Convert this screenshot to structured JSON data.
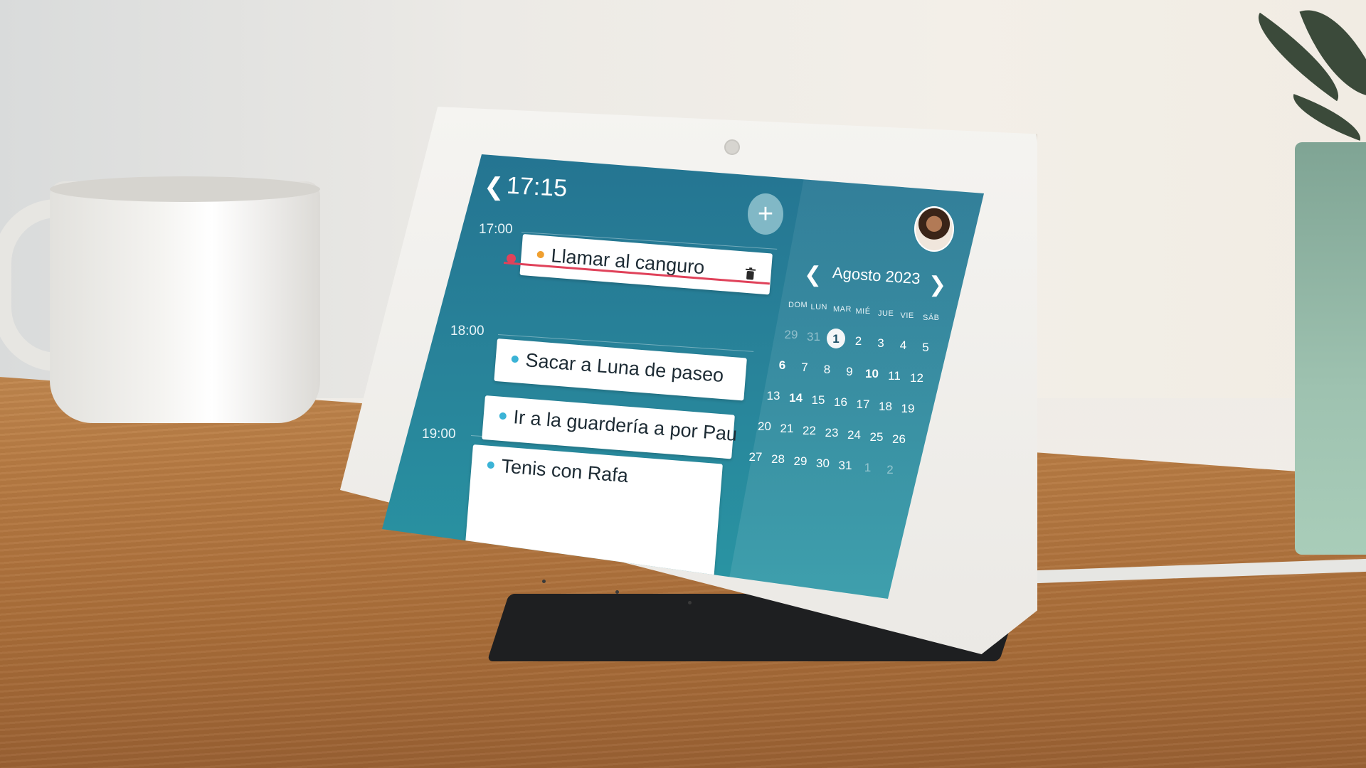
{
  "header": {
    "back_icon": "chevron-left-icon",
    "time": "17:15",
    "add_icon": "plus-icon",
    "add_label": "+"
  },
  "timeline": {
    "hours": [
      "17:00",
      "18:00",
      "19:00"
    ],
    "events": [
      {
        "title": "Llamar al canguro",
        "completed": true,
        "dot_color": "#f0a030"
      },
      {
        "title": "Sacar a Luna de paseo",
        "completed": false,
        "dot_color": "#3bb3d6"
      },
      {
        "title": "Ir a la guardería a por Pau",
        "completed": false,
        "dot_color": "#3bb3d6"
      },
      {
        "title": "Tenis con Rafa",
        "completed": false,
        "dot_color": "#3bb3d6"
      }
    ]
  },
  "calendar": {
    "month_title": "Agosto 2023",
    "prev_icon": "chevron-left-icon",
    "next_icon": "chevron-right-icon",
    "weekdays": [
      "DOM",
      "LUN",
      "MAR",
      "MIÉ",
      "JUE",
      "VIE",
      "SÁB"
    ],
    "weeks": [
      [
        "29",
        "31",
        "1",
        "2",
        "3",
        "4",
        "5"
      ],
      [
        "6",
        "7",
        "8",
        "9",
        "10",
        "11",
        "12"
      ],
      [
        "13",
        "14",
        "15",
        "16",
        "17",
        "18",
        "19"
      ],
      [
        "20",
        "21",
        "22",
        "23",
        "24",
        "25",
        "26"
      ],
      [
        "27",
        "28",
        "29",
        "30",
        "31",
        "1",
        "2"
      ]
    ],
    "today": "1",
    "bold_days": [
      "6",
      "10",
      "14"
    ]
  },
  "colors": {
    "accent_strike": "#e0425a",
    "screen_top": "#226a8c",
    "screen_bottom": "#2aa3ab"
  }
}
